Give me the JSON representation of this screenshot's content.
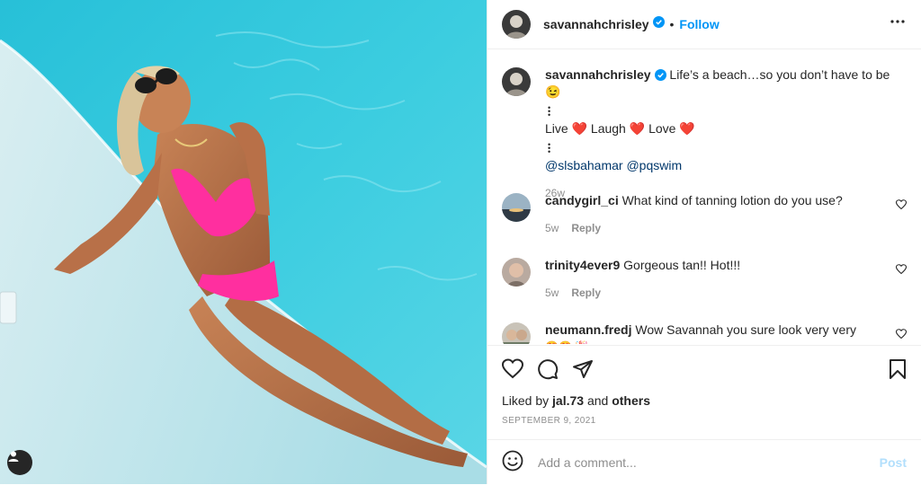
{
  "header": {
    "username": "savannahchrisley",
    "dot": "•",
    "follow_label": "Follow"
  },
  "caption": {
    "username": "savannahchrisley",
    "text": "Life’s a beach…so you don’t have to be😉",
    "ellipsis_1": "•\n•\n•",
    "line_live": "Live",
    "line_laugh": "Laugh",
    "line_love": "Love",
    "heart": "❤️",
    "ellipsis_2": "•\n•\n•",
    "mention_1": "@slsbahamar",
    "mention_2": "@pqswim",
    "age": "26w"
  },
  "comments": [
    {
      "username": "candygirl_ci",
      "text": "What kind of tanning lotion do you use?",
      "age": "5w",
      "reply": "Reply"
    },
    {
      "username": "trinity4ever9",
      "text": "Gorgeous tan!! Hot!!!",
      "age": "5w",
      "reply": "Reply"
    },
    {
      "username": "neumann.fredj",
      "text": "Wow Savannah you sure look very very",
      "partial": "😍😍 🎉"
    }
  ],
  "actions": {
    "liked_prefix": "Liked by",
    "liked_user": "jal.73",
    "liked_and": "and",
    "liked_others": "others",
    "date": "SEPTEMBER 9, 2021"
  },
  "add_comment": {
    "placeholder": "Add a comment...",
    "post_label": "Post"
  },
  "icons": {
    "more": "more-options-icon",
    "verified": "verified-badge-icon",
    "like": "heart-icon",
    "comment": "comment-icon",
    "share": "share-icon",
    "save": "bookmark-icon",
    "emoji": "emoji-icon",
    "tag": "user-tag-icon"
  },
  "colors": {
    "accent": "#0095f6",
    "verified": "#0095f6",
    "muted": "#8e8e8e",
    "post_disabled": "#b2dffc",
    "heart": "#ed4956"
  }
}
